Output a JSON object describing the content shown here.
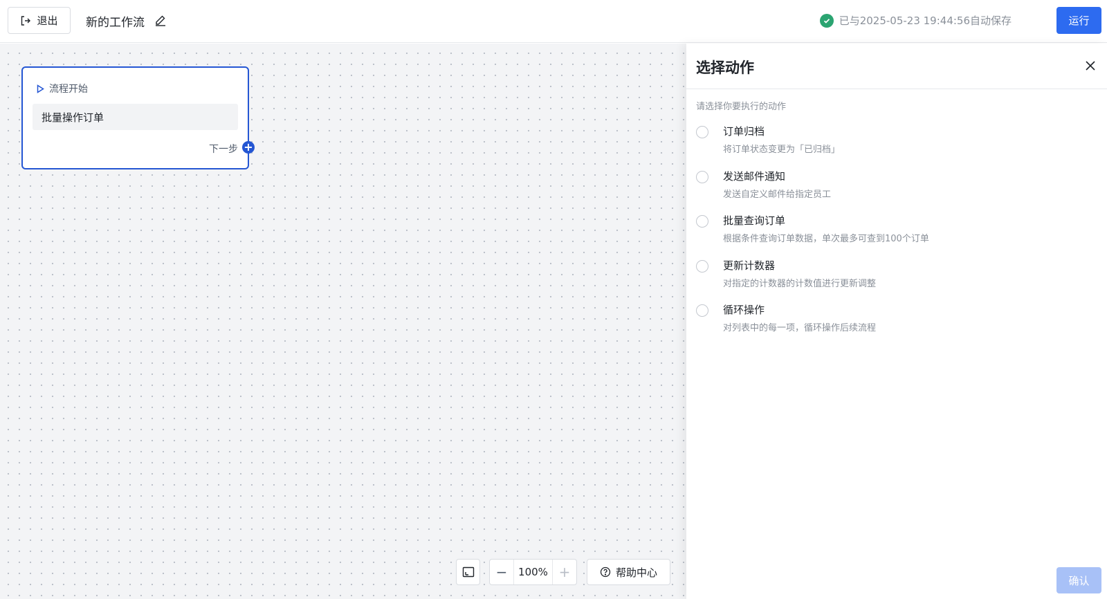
{
  "header": {
    "exit_label": "退出",
    "workflow_title": "新的工作流",
    "save_status": "已与2025-05-23 19:44:56自动保存",
    "run_label": "运行"
  },
  "canvas": {
    "node": {
      "head_label": "流程开始",
      "body_label": "批量操作订单",
      "next_label": "下一步"
    },
    "zoom_value": "100%",
    "help_label": "帮助中心"
  },
  "panel": {
    "title": "选择动作",
    "hint": "请选择你要执行的动作",
    "actions": [
      {
        "name": "订单归档",
        "desc": "将订单状态变更为「已归档」"
      },
      {
        "name": "发送邮件通知",
        "desc": "发送自定义邮件给指定员工"
      },
      {
        "name": "批量查询订单",
        "desc": "根据条件查询订单数据，单次最多可查到100个订单"
      },
      {
        "name": "更新计数器",
        "desc": "对指定的计数器的计数值进行更新调整"
      },
      {
        "name": "循环操作",
        "desc": "对列表中的每一项，循环操作后续流程"
      }
    ],
    "confirm_label": "确认"
  },
  "colors": {
    "primary": "#2d6bf0",
    "node_border": "#2456d3",
    "success": "#2ba471",
    "confirm_disabled": "#a8c1f7"
  }
}
